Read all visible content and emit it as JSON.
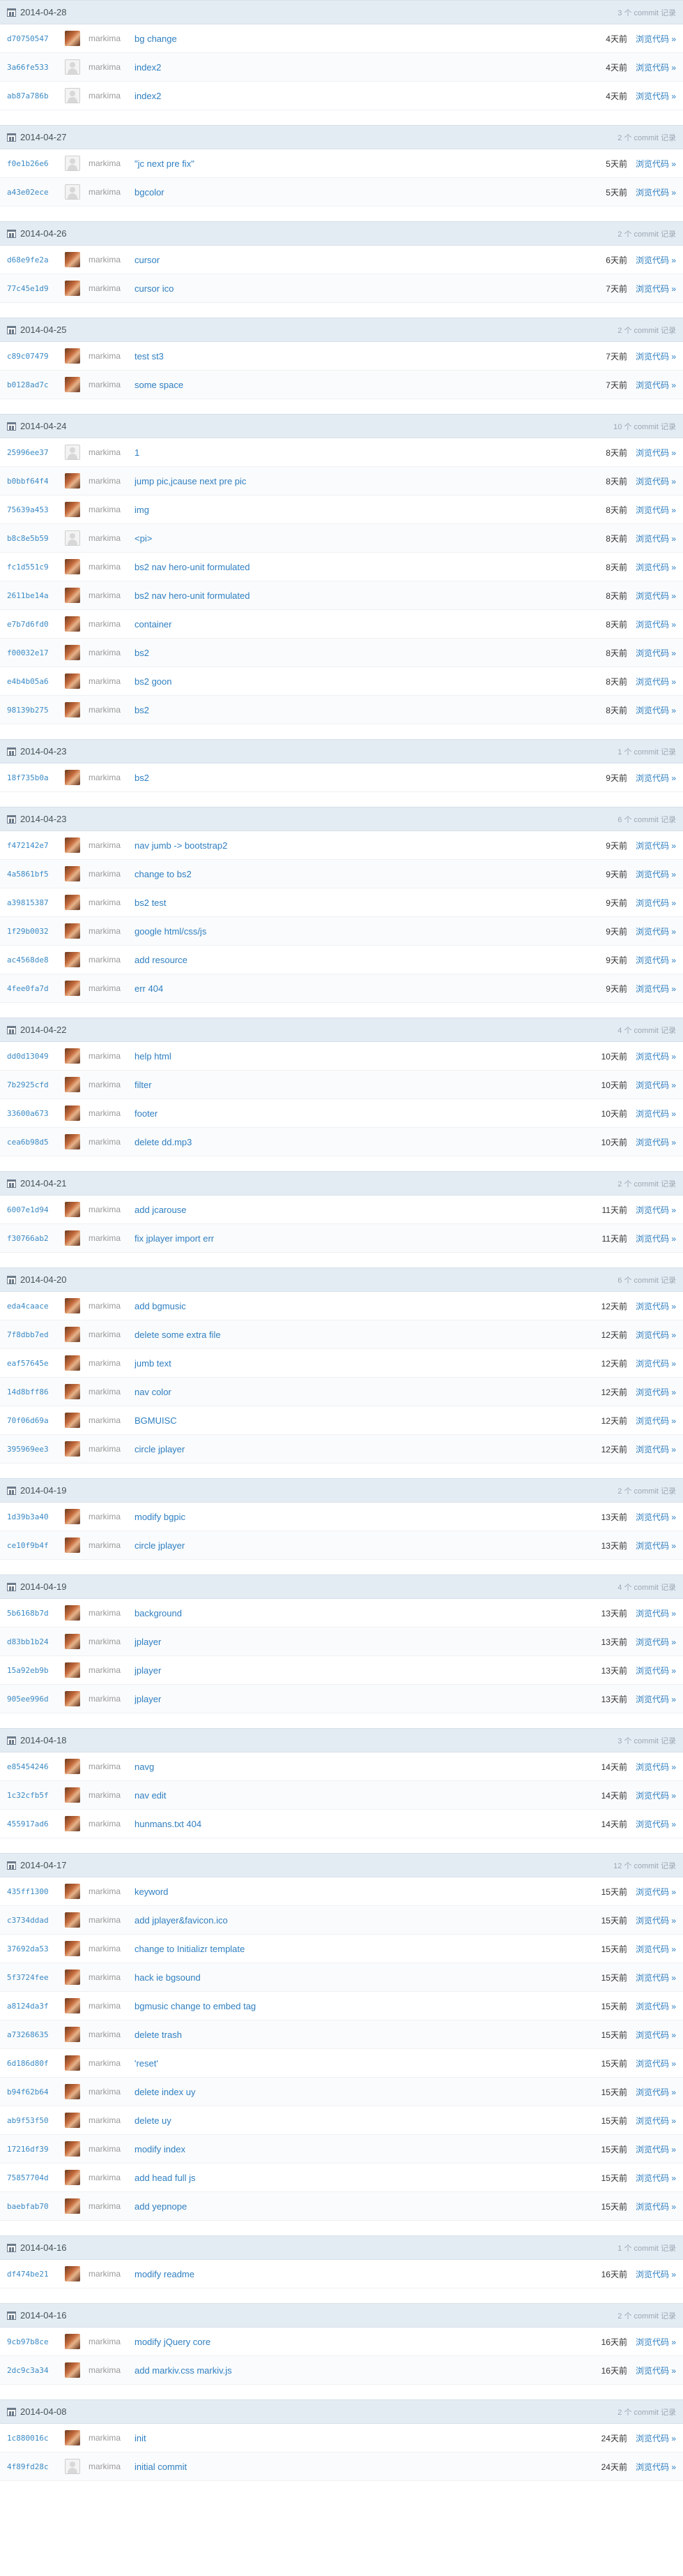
{
  "groups": [
    {
      "date": "2014-04-28",
      "count_label": "3 个 commit 记录",
      "commits": [
        {
          "sha": "d70750547",
          "avatar": "photo",
          "author": "markima",
          "message": "bg change",
          "time": "4天前",
          "browse": "浏览代码 »"
        },
        {
          "sha": "3a66fe533",
          "avatar": "blank",
          "author": "markima",
          "message": "index2",
          "time": "4天前",
          "browse": "浏览代码 »"
        },
        {
          "sha": "ab87a786b",
          "avatar": "blank",
          "author": "markima",
          "message": "index2",
          "time": "4天前",
          "browse": "浏览代码 »"
        }
      ]
    },
    {
      "date": "2014-04-27",
      "count_label": "2 个 commit 记录",
      "commits": [
        {
          "sha": "f0e1b26e6",
          "avatar": "blank",
          "author": "markima",
          "message": "\"jc next pre fix\"",
          "time": "5天前",
          "browse": "浏览代码 »"
        },
        {
          "sha": "a43e02ece",
          "avatar": "blank",
          "author": "markima",
          "message": "bgcolor",
          "time": "5天前",
          "browse": "浏览代码 »"
        }
      ]
    },
    {
      "date": "2014-04-26",
      "count_label": "2 个 commit 记录",
      "commits": [
        {
          "sha": "d68e9fe2a",
          "avatar": "photo",
          "author": "markima",
          "message": "cursor",
          "time": "6天前",
          "browse": "浏览代码 »"
        },
        {
          "sha": "77c45e1d9",
          "avatar": "photo",
          "author": "markima",
          "message": "cursor ico",
          "time": "7天前",
          "browse": "浏览代码 »"
        }
      ]
    },
    {
      "date": "2014-04-25",
      "count_label": "2 个 commit 记录",
      "commits": [
        {
          "sha": "c89c07479",
          "avatar": "photo",
          "author": "markima",
          "message": "test st3",
          "time": "7天前",
          "browse": "浏览代码 »"
        },
        {
          "sha": "b0128ad7c",
          "avatar": "photo",
          "author": "markima",
          "message": "some space",
          "time": "7天前",
          "browse": "浏览代码 »"
        }
      ]
    },
    {
      "date": "2014-04-24",
      "count_label": "10 个 commit 记录",
      "commits": [
        {
          "sha": "25996ee37",
          "avatar": "blank",
          "author": "markima",
          "message": "1",
          "time": "8天前",
          "browse": "浏览代码 »"
        },
        {
          "sha": "b0bbf64f4",
          "avatar": "photo",
          "author": "markima",
          "message": "jump pic,jcause next pre pic",
          "time": "8天前",
          "browse": "浏览代码 »"
        },
        {
          "sha": "75639a453",
          "avatar": "photo",
          "author": "markima",
          "message": "img",
          "time": "8天前",
          "browse": "浏览代码 »"
        },
        {
          "sha": "b8c8e5b59",
          "avatar": "blank",
          "author": "markima",
          "message": "<pi>",
          "time": "8天前",
          "browse": "浏览代码 »"
        },
        {
          "sha": "fc1d551c9",
          "avatar": "photo",
          "author": "markima",
          "message": "bs2 nav hero-unit formulated",
          "time": "8天前",
          "browse": "浏览代码 »"
        },
        {
          "sha": "2611be14a",
          "avatar": "photo",
          "author": "markima",
          "message": "bs2 nav hero-unit formulated",
          "time": "8天前",
          "browse": "浏览代码 »"
        },
        {
          "sha": "e7b7d6fd0",
          "avatar": "photo",
          "author": "markima",
          "message": "container",
          "time": "8天前",
          "browse": "浏览代码 »"
        },
        {
          "sha": "f00032e17",
          "avatar": "photo",
          "author": "markima",
          "message": "bs2",
          "time": "8天前",
          "browse": "浏览代码 »"
        },
        {
          "sha": "e4b4b05a6",
          "avatar": "photo",
          "author": "markima",
          "message": "bs2 goon",
          "time": "8天前",
          "browse": "浏览代码 »"
        },
        {
          "sha": "98139b275",
          "avatar": "photo",
          "author": "markima",
          "message": "bs2",
          "time": "8天前",
          "browse": "浏览代码 »"
        }
      ]
    },
    {
      "date": "2014-04-23",
      "count_label": "1 个 commit 记录",
      "commits": [
        {
          "sha": "18f735b0a",
          "avatar": "photo",
          "author": "markima",
          "message": "bs2",
          "time": "9天前",
          "browse": "浏览代码 »"
        }
      ]
    },
    {
      "date": "2014-04-23",
      "count_label": "6 个 commit 记录",
      "commits": [
        {
          "sha": "f472142e7",
          "avatar": "photo",
          "author": "markima",
          "message": "nav jumb -> bootstrap2",
          "time": "9天前",
          "browse": "浏览代码 »"
        },
        {
          "sha": "4a5861bf5",
          "avatar": "photo",
          "author": "markima",
          "message": "change to bs2",
          "time": "9天前",
          "browse": "浏览代码 »"
        },
        {
          "sha": "a39815387",
          "avatar": "photo",
          "author": "markima",
          "message": "bs2 test",
          "time": "9天前",
          "browse": "浏览代码 »"
        },
        {
          "sha": "1f29b0032",
          "avatar": "photo",
          "author": "markima",
          "message": "google html/css/js",
          "time": "9天前",
          "browse": "浏览代码 »"
        },
        {
          "sha": "ac4568de8",
          "avatar": "photo",
          "author": "markima",
          "message": "add resource",
          "time": "9天前",
          "browse": "浏览代码 »"
        },
        {
          "sha": "4fee0fa7d",
          "avatar": "photo",
          "author": "markima",
          "message": "err 404",
          "time": "9天前",
          "browse": "浏览代码 »"
        }
      ]
    },
    {
      "date": "2014-04-22",
      "count_label": "4 个 commit 记录",
      "commits": [
        {
          "sha": "dd0d13049",
          "avatar": "photo",
          "author": "markima",
          "message": "help html",
          "time": "10天前",
          "browse": "浏览代码 »"
        },
        {
          "sha": "7b2925cfd",
          "avatar": "photo",
          "author": "markima",
          "message": "filter",
          "time": "10天前",
          "browse": "浏览代码 »"
        },
        {
          "sha": "33600a673",
          "avatar": "photo",
          "author": "markima",
          "message": "footer",
          "time": "10天前",
          "browse": "浏览代码 »"
        },
        {
          "sha": "cea6b98d5",
          "avatar": "photo",
          "author": "markima",
          "message": "delete dd.mp3",
          "time": "10天前",
          "browse": "浏览代码 »"
        }
      ]
    },
    {
      "date": "2014-04-21",
      "count_label": "2 个 commit 记录",
      "commits": [
        {
          "sha": "6007e1d94",
          "avatar": "photo",
          "author": "markima",
          "message": "add jcarouse",
          "time": "11天前",
          "browse": "浏览代码 »"
        },
        {
          "sha": "f30766ab2",
          "avatar": "photo",
          "author": "markima",
          "message": "fix jplayer import err",
          "time": "11天前",
          "browse": "浏览代码 »"
        }
      ]
    },
    {
      "date": "2014-04-20",
      "count_label": "6 个 commit 记录",
      "commits": [
        {
          "sha": "eda4caace",
          "avatar": "photo",
          "author": "markima",
          "message": "add bgmusic",
          "time": "12天前",
          "browse": "浏览代码 »"
        },
        {
          "sha": "7f8dbb7ed",
          "avatar": "photo",
          "author": "markima",
          "message": "delete some extra file",
          "time": "12天前",
          "browse": "浏览代码 »"
        },
        {
          "sha": "eaf57645e",
          "avatar": "photo",
          "author": "markima",
          "message": "jumb text",
          "time": "12天前",
          "browse": "浏览代码 »"
        },
        {
          "sha": "14d8bff86",
          "avatar": "photo",
          "author": "markima",
          "message": "nav color",
          "time": "12天前",
          "browse": "浏览代码 »"
        },
        {
          "sha": "70f06d69a",
          "avatar": "photo",
          "author": "markima",
          "message": "BGMUISC",
          "time": "12天前",
          "browse": "浏览代码 »"
        },
        {
          "sha": "395969ee3",
          "avatar": "photo",
          "author": "markima",
          "message": "circle jplayer",
          "time": "12天前",
          "browse": "浏览代码 »"
        }
      ]
    },
    {
      "date": "2014-04-19",
      "count_label": "2 个 commit 记录",
      "commits": [
        {
          "sha": "1d39b3a40",
          "avatar": "photo",
          "author": "markima",
          "message": "modify bgpic",
          "time": "13天前",
          "browse": "浏览代码 »"
        },
        {
          "sha": "ce10f9b4f",
          "avatar": "photo",
          "author": "markima",
          "message": "circle jplayer",
          "time": "13天前",
          "browse": "浏览代码 »"
        }
      ]
    },
    {
      "date": "2014-04-19",
      "count_label": "4 个 commit 记录",
      "commits": [
        {
          "sha": "5b6168b7d",
          "avatar": "photo",
          "author": "markima",
          "message": "background",
          "time": "13天前",
          "browse": "浏览代码 »"
        },
        {
          "sha": "d83bb1b24",
          "avatar": "photo",
          "author": "markima",
          "message": "jplayer",
          "time": "13天前",
          "browse": "浏览代码 »"
        },
        {
          "sha": "15a92eb9b",
          "avatar": "photo",
          "author": "markima",
          "message": "jplayer",
          "time": "13天前",
          "browse": "浏览代码 »"
        },
        {
          "sha": "905ee996d",
          "avatar": "photo",
          "author": "markima",
          "message": "jplayer",
          "time": "13天前",
          "browse": "浏览代码 »"
        }
      ]
    },
    {
      "date": "2014-04-18",
      "count_label": "3 个 commit 记录",
      "commits": [
        {
          "sha": "e85454246",
          "avatar": "photo",
          "author": "markima",
          "message": "navg",
          "time": "14天前",
          "browse": "浏览代码 »"
        },
        {
          "sha": "1c32cfb5f",
          "avatar": "photo",
          "author": "markima",
          "message": "nav edit",
          "time": "14天前",
          "browse": "浏览代码 »"
        },
        {
          "sha": "455917ad6",
          "avatar": "photo",
          "author": "markima",
          "message": "hunmans.txt 404",
          "time": "14天前",
          "browse": "浏览代码 »"
        }
      ]
    },
    {
      "date": "2014-04-17",
      "count_label": "12 个 commit 记录",
      "commits": [
        {
          "sha": "435ff1300",
          "avatar": "photo",
          "author": "markima",
          "message": "keyword",
          "time": "15天前",
          "browse": "浏览代码 »"
        },
        {
          "sha": "c3734ddad",
          "avatar": "photo",
          "author": "markima",
          "message": "add jplayer&favicon.ico",
          "time": "15天前",
          "browse": "浏览代码 »"
        },
        {
          "sha": "37692da53",
          "avatar": "photo",
          "author": "markima",
          "message": "change to Initializr template",
          "time": "15天前",
          "browse": "浏览代码 »"
        },
        {
          "sha": "5f3724fee",
          "avatar": "photo",
          "author": "markima",
          "message": "hack ie bgsound",
          "time": "15天前",
          "browse": "浏览代码 »"
        },
        {
          "sha": "a8124da3f",
          "avatar": "photo",
          "author": "markima",
          "message": "bgmusic change to embed tag",
          "time": "15天前",
          "browse": "浏览代码 »"
        },
        {
          "sha": "a73268635",
          "avatar": "photo",
          "author": "markima",
          "message": "delete trash",
          "time": "15天前",
          "browse": "浏览代码 »"
        },
        {
          "sha": "6d186d80f",
          "avatar": "photo",
          "author": "markima",
          "message": "'reset'",
          "time": "15天前",
          "browse": "浏览代码 »"
        },
        {
          "sha": "b94f62b64",
          "avatar": "photo",
          "author": "markima",
          "message": "delete index uy",
          "time": "15天前",
          "browse": "浏览代码 »"
        },
        {
          "sha": "ab9f53f50",
          "avatar": "photo",
          "author": "markima",
          "message": "delete uy",
          "time": "15天前",
          "browse": "浏览代码 »"
        },
        {
          "sha": "17216df39",
          "avatar": "photo",
          "author": "markima",
          "message": "modify index",
          "time": "15天前",
          "browse": "浏览代码 »"
        },
        {
          "sha": "75857704d",
          "avatar": "photo",
          "author": "markima",
          "message": "add head full js",
          "time": "15天前",
          "browse": "浏览代码 »"
        },
        {
          "sha": "baebfab70",
          "avatar": "photo",
          "author": "markima",
          "message": "add yepnope",
          "time": "15天前",
          "browse": "浏览代码 »"
        }
      ]
    },
    {
      "date": "2014-04-16",
      "count_label": "1 个 commit 记录",
      "commits": [
        {
          "sha": "df474be21",
          "avatar": "photo",
          "author": "markima",
          "message": "modify readme",
          "time": "16天前",
          "browse": "浏览代码 »"
        }
      ]
    },
    {
      "date": "2014-04-16",
      "count_label": "2 个 commit 记录",
      "commits": [
        {
          "sha": "9cb97b8ce",
          "avatar": "photo",
          "author": "markima",
          "message": "modify jQuery core",
          "time": "16天前",
          "browse": "浏览代码 »"
        },
        {
          "sha": "2dc9c3a34",
          "avatar": "photo",
          "author": "markima",
          "message": "add markiv.css markiv.js",
          "time": "16天前",
          "browse": "浏览代码 »"
        }
      ]
    },
    {
      "date": "2014-04-08",
      "count_label": "2 个 commit 记录",
      "commits": [
        {
          "sha": "1c880016c",
          "avatar": "photo",
          "author": "markima",
          "message": "init",
          "time": "24天前",
          "browse": "浏览代码 »"
        },
        {
          "sha": "4f89fd28c",
          "avatar": "blank",
          "author": "markima",
          "message": "initial commit",
          "time": "24天前",
          "browse": "浏览代码 »"
        }
      ]
    }
  ]
}
